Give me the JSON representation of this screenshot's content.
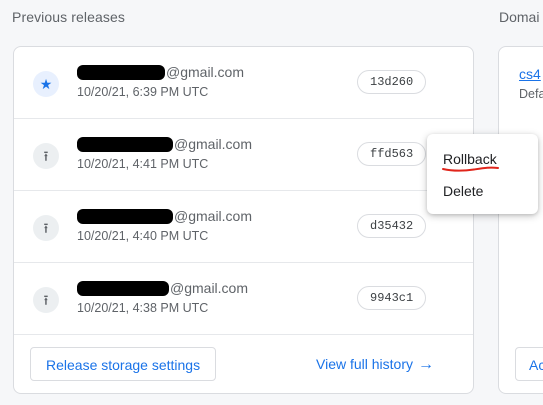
{
  "header": {
    "title": "Previous releases",
    "right_title": "Domai"
  },
  "releases": [
    {
      "icon": "star-icon",
      "user_suffix": "@gmail.com",
      "date": "10/20/21, 6:39 PM UTC",
      "hash": "13d260"
    },
    {
      "icon": "deploy-icon",
      "user_suffix": "@gmail.com",
      "date": "10/20/21, 4:41 PM UTC",
      "hash": "ffd563"
    },
    {
      "icon": "deploy-icon",
      "user_suffix": "@gmail.com",
      "date": "10/20/21, 4:40 PM UTC",
      "hash": "d35432"
    },
    {
      "icon": "deploy-icon",
      "user_suffix": "@gmail.com",
      "date": "10/20/21, 4:38 PM UTC",
      "hash": "9943c1"
    }
  ],
  "footer": {
    "storage_button": "Release storage settings",
    "history_link": "View full history",
    "history_arrow": "→"
  },
  "menu": {
    "rollback": "Rollback",
    "delete": "Delete"
  },
  "side_panel": {
    "link": "cs4",
    "sub": "Defa",
    "button": "Ac"
  },
  "colors": {
    "accent": "#1a73e8",
    "annotation": "#e0251b"
  }
}
